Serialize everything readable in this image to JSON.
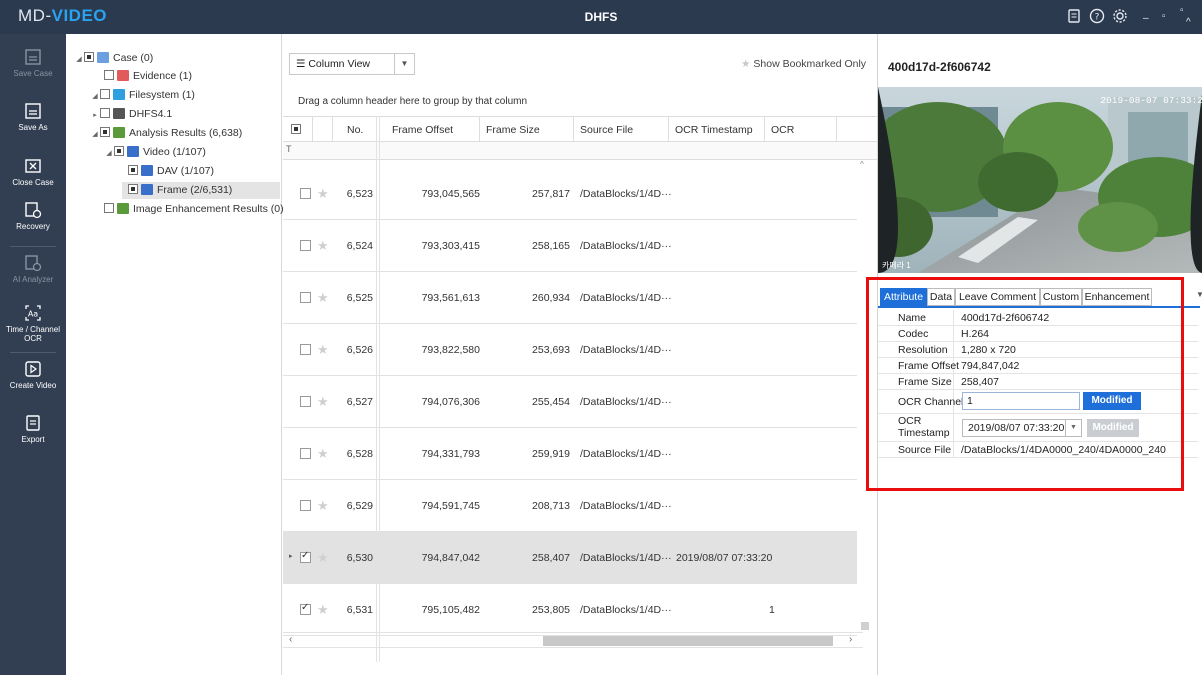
{
  "app": {
    "logo_part1": "MD-",
    "logo_part2": "VIDEO",
    "title": "DHFS"
  },
  "titlebar_icons": [
    "report-icon",
    "help-icon",
    "gear-icon"
  ],
  "toolbar": [
    {
      "label": "Save Case",
      "icon": "save-icon",
      "enabled": false
    },
    {
      "label": "Save As",
      "icon": "save-as-icon",
      "enabled": true
    },
    {
      "label": "Close Case",
      "icon": "close-case-icon",
      "enabled": true
    },
    {
      "label": "Recovery",
      "icon": "recovery-icon",
      "enabled": true
    },
    {
      "label": "AI Analyzer",
      "icon": "ai-analyzer-icon",
      "enabled": false
    },
    {
      "label": "Time / Channel",
      "label2": "OCR",
      "icon": "ocr-icon",
      "enabled": true
    },
    {
      "label": "Create Video",
      "icon": "play-icon",
      "enabled": true
    },
    {
      "label": "Export",
      "icon": "export-icon",
      "enabled": true
    }
  ],
  "tree": [
    {
      "label": "Case (0)",
      "color": "#6b9fe0"
    },
    {
      "label": "Evidence (1)",
      "color": "#e25a5a"
    },
    {
      "label": "Filesystem (1)",
      "color": "#2ea0df"
    },
    {
      "label": "DHFS4.1",
      "color": "#555555"
    },
    {
      "label": "Analysis Results (6,638)",
      "color": "#5a9a3a"
    },
    {
      "label": "Video (1/107)",
      "color": "#3a6fc9"
    },
    {
      "label": "DAV (1/107)",
      "color": "#3a6fc9"
    },
    {
      "label": "Frame (2/6,531)",
      "color": "#3a6fc9"
    },
    {
      "label": "Image Enhancement Results (0)",
      "color": "#5a9a3a"
    }
  ],
  "grid": {
    "view_select": "Column View",
    "bookmark_label": "Show Bookmarked Only",
    "group_hint": "Drag a column header here to group by that column",
    "columns": [
      "No.",
      "Frame Offset",
      "Frame Size",
      "Source File",
      "OCR Timestamp",
      "OCR Channel"
    ],
    "rows": [
      {
        "no": "6,523",
        "offset": "793,045,565",
        "size": "257,817",
        "src": "/DataBlocks/1/4D···",
        "ts": "",
        "ch": "",
        "checked": false
      },
      {
        "no": "6,524",
        "offset": "793,303,415",
        "size": "258,165",
        "src": "/DataBlocks/1/4D···",
        "ts": "",
        "ch": "",
        "checked": false
      },
      {
        "no": "6,525",
        "offset": "793,561,613",
        "size": "260,934",
        "src": "/DataBlocks/1/4D···",
        "ts": "",
        "ch": "",
        "checked": false
      },
      {
        "no": "6,526",
        "offset": "793,822,580",
        "size": "253,693",
        "src": "/DataBlocks/1/4D···",
        "ts": "",
        "ch": "",
        "checked": false
      },
      {
        "no": "6,527",
        "offset": "794,076,306",
        "size": "255,454",
        "src": "/DataBlocks/1/4D···",
        "ts": "",
        "ch": "",
        "checked": false
      },
      {
        "no": "6,528",
        "offset": "794,331,793",
        "size": "259,919",
        "src": "/DataBlocks/1/4D···",
        "ts": "",
        "ch": "",
        "checked": false
      },
      {
        "no": "6,529",
        "offset": "794,591,745",
        "size": "208,713",
        "src": "/DataBlocks/1/4D···",
        "ts": "",
        "ch": "",
        "checked": false
      },
      {
        "no": "6,530",
        "offset": "794,847,042",
        "size": "258,407",
        "src": "/DataBlocks/1/4D···",
        "ts": "2019/08/07 07:33:20",
        "ch": "",
        "checked": true
      },
      {
        "no": "6,531",
        "offset": "795,105,482",
        "size": "253,805",
        "src": "/DataBlocks/1/4D···",
        "ts": "",
        "ch": "1",
        "checked": true
      }
    ]
  },
  "detail": {
    "title": "400d17d-2f606742",
    "preview_timestamp": "2019-08-07 07:33:2",
    "camera_label": "카메라 1",
    "tabs": [
      "Attribute",
      "Data",
      "Leave Comment",
      "Custom",
      "Enhancement"
    ],
    "attrs": {
      "name_k": "Name",
      "name_v": "400d17d-2f606742",
      "codec_k": "Codec",
      "codec_v": "H.264",
      "res_k": "Resolution",
      "res_v": "1,280 x 720",
      "off_k": "Frame Offset",
      "off_v": "794,847,042",
      "size_k": "Frame Size",
      "size_v": "258,407",
      "ch_k": "OCR Channel",
      "ch_v": "1",
      "ch_btn": "Modified",
      "ts_k1": "OCR",
      "ts_k2": "Timestamp",
      "ts_v": "2019/08/07 07:33:20",
      "ts_btn": "Modified",
      "src_k": "Source File",
      "src_v": "/DataBlocks/1/4DA0000_240/4DA0000_240"
    },
    "accent": "#1e6fd9",
    "highlight": "#ea0d0d"
  }
}
